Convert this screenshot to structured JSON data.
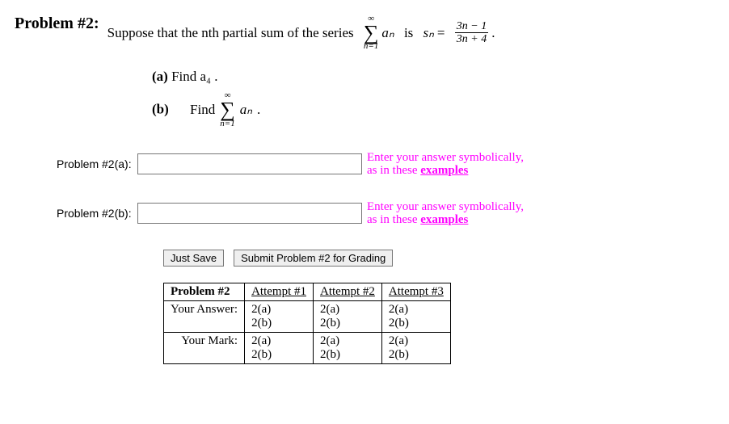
{
  "problem": {
    "title": "Problem #2:",
    "statement": "Suppose that the nth partial sum of the series",
    "series_var": "aₙ",
    "series_lower": "n=1",
    "series_upper": "∞",
    "sn_text": "is",
    "sn_var": "sₙ",
    "equals": "=",
    "frac_top": "3n − 1",
    "frac_bot": "3n + 4",
    "dot": "."
  },
  "parts": {
    "a": {
      "label": "(a)",
      "text": "Find a₄ ."
    },
    "b": {
      "label": "(b)",
      "text": "Find",
      "series_upper": "∞",
      "series_lower": "n=1",
      "series_var": "aₙ",
      "dot": "."
    }
  },
  "answers": {
    "a": {
      "label": "Problem #2(a):",
      "hint_pre": "Enter your answer symbolically,",
      "hint_post": "as in these ",
      "hint_link": "examples"
    },
    "b": {
      "label": "Problem #2(b):",
      "hint_pre": "Enter your answer symbolically,",
      "hint_post": "as in these ",
      "hint_link": "examples"
    }
  },
  "buttons": {
    "save": "Just Save",
    "submit": "Submit Problem #2 for Grading"
  },
  "table": {
    "header": "Problem #2",
    "cols": [
      "Attempt #1",
      "Attempt #2",
      "Attempt #3"
    ],
    "rows": [
      {
        "label": "Your Answer:",
        "cells": [
          [
            "2(a)",
            "2(b)"
          ],
          [
            "2(a)",
            "2(b)"
          ],
          [
            "2(a)",
            "2(b)"
          ]
        ]
      },
      {
        "label": "Your Mark:",
        "cells": [
          [
            "2(a)",
            "2(b)"
          ],
          [
            "2(a)",
            "2(b)"
          ],
          [
            "2(a)",
            "2(b)"
          ]
        ]
      }
    ]
  }
}
